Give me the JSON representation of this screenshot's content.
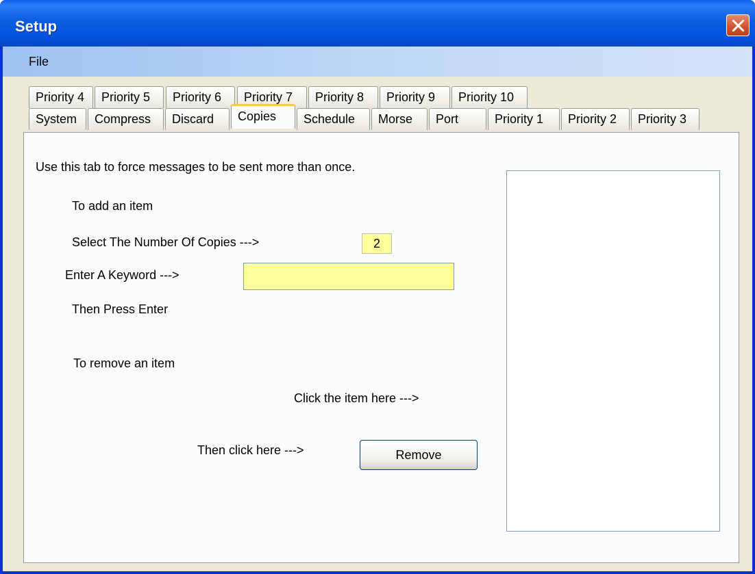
{
  "window": {
    "title": "Setup"
  },
  "menu": {
    "file_label": "File"
  },
  "tabs_row_back": [
    {
      "label": "Priority 4"
    },
    {
      "label": "Priority 5"
    },
    {
      "label": "Priority 6"
    },
    {
      "label": "Priority 7"
    },
    {
      "label": "Priority 8"
    },
    {
      "label": "Priority 9"
    },
    {
      "label": "Priority 10"
    }
  ],
  "tabs_row_front": [
    {
      "label": "System"
    },
    {
      "label": "Compress"
    },
    {
      "label": "Discard"
    },
    {
      "label": "Copies",
      "selected": true
    },
    {
      "label": "Schedule"
    },
    {
      "label": "Morse"
    },
    {
      "label": "Port"
    },
    {
      "label": "Priority 1"
    },
    {
      "label": "Priority 2"
    },
    {
      "label": "Priority 3"
    }
  ],
  "copies_tab": {
    "description": "Use this tab to force messages to be sent more than once.",
    "add_heading": "To add an item",
    "select_copies_label": "Select The Number Of Copies --->",
    "copies_value": "2",
    "keyword_label": "Enter A Keyword --->",
    "keyword_value": "",
    "press_enter": "Then Press Enter",
    "remove_heading": "To remove an item",
    "click_item_label": "Click the item here --->",
    "then_click_label": "Then click here --->",
    "remove_button_label": "Remove",
    "keyword_list": []
  },
  "colors": {
    "input_background": "#ffff99",
    "active_tab_highlight": "#ffc83c",
    "titlebar": "#0451dd"
  }
}
